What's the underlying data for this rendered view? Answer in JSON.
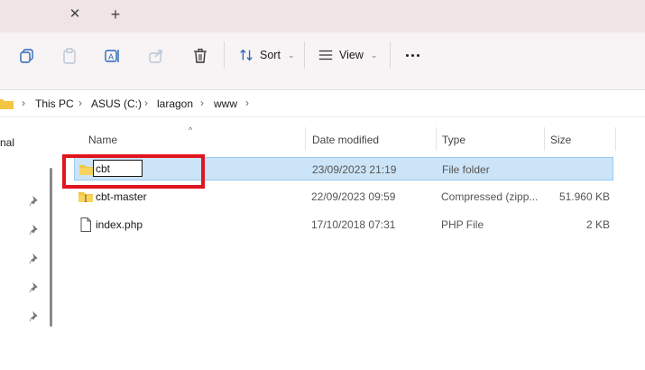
{
  "tabbar": {
    "close_label": "✕",
    "new_tab_label": "+"
  },
  "toolbar": {
    "copy_icon": "copy-icon",
    "paste_icon": "paste-icon",
    "rename_icon": "rename-icon",
    "share_icon": "share-icon",
    "delete_icon": "delete-icon",
    "sort_label": "Sort",
    "view_label": "View",
    "more_icon": "more-icon"
  },
  "address": {
    "crumbs": [
      "This PC",
      "ASUS (C:)",
      "laragon",
      "www"
    ]
  },
  "nav": {
    "partial_label": "nal",
    "pins": 5
  },
  "columns": {
    "name": "Name",
    "date": "Date modified",
    "type": "Type",
    "size": "Size"
  },
  "files": [
    {
      "name": "cbt",
      "date": "23/09/2023 21:19",
      "type": "File folder",
      "size": "",
      "icon": "folder-icon",
      "selected": true,
      "renaming": true
    },
    {
      "name": "cbt-master",
      "date": "22/09/2023 09:59",
      "type": "Compressed (zipp...",
      "size": "51.960 KB",
      "icon": "zip-folder-icon"
    },
    {
      "name": "index.php",
      "date": "17/10/2018 07:31",
      "type": "PHP File",
      "size": "2 KB",
      "icon": "document-icon"
    }
  ],
  "colors": {
    "selection": "#cce4f7",
    "highlight": "#e0151f",
    "folder": "#f4c542",
    "accent": "#2a66b8"
  }
}
